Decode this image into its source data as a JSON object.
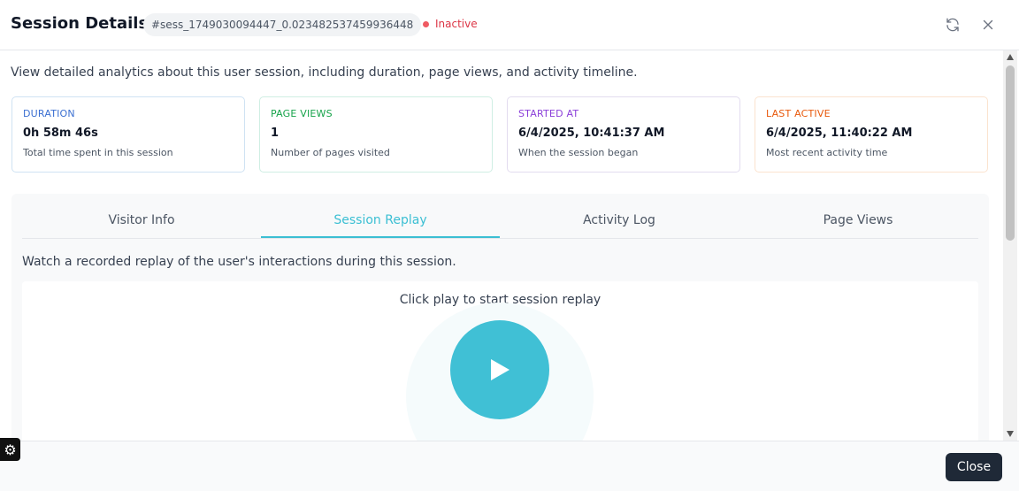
{
  "header": {
    "title": "Session Details",
    "session_id": "#sess_1749030094447_0.023482537459936448",
    "status": "Inactive",
    "status_color": "#dc3545"
  },
  "description": "View detailed analytics about this user session, including duration, page views, and activity timeline.",
  "stats": [
    {
      "label": "DURATION",
      "value": "0h 58m 46s",
      "sub": "Total time spent in this session",
      "color": "#3b6fd1"
    },
    {
      "label": "PAGE VIEWS",
      "value": "1",
      "sub": "Number of pages visited",
      "color": "#16a34a"
    },
    {
      "label": "STARTED AT",
      "value": "6/4/2025, 10:41:37 AM",
      "sub": "When the session began",
      "color": "#8b3fd9"
    },
    {
      "label": "LAST ACTIVE",
      "value": "6/4/2025, 11:40:22 AM",
      "sub": "Most recent activity time",
      "color": "#e8590c"
    }
  ],
  "tabs": [
    {
      "label": "Visitor Info",
      "active": false
    },
    {
      "label": "Session Replay",
      "active": true
    },
    {
      "label": "Activity Log",
      "active": false
    },
    {
      "label": "Page Views",
      "active": false
    }
  ],
  "replay": {
    "description": "Watch a recorded replay of the user's interactions during this session.",
    "hint": "Click play to start session replay",
    "accent": "#40c0d5"
  },
  "footer": {
    "close_label": "Close"
  },
  "icons": [
    "refresh-icon",
    "close-icon",
    "play-icon",
    "gear-icon"
  ]
}
